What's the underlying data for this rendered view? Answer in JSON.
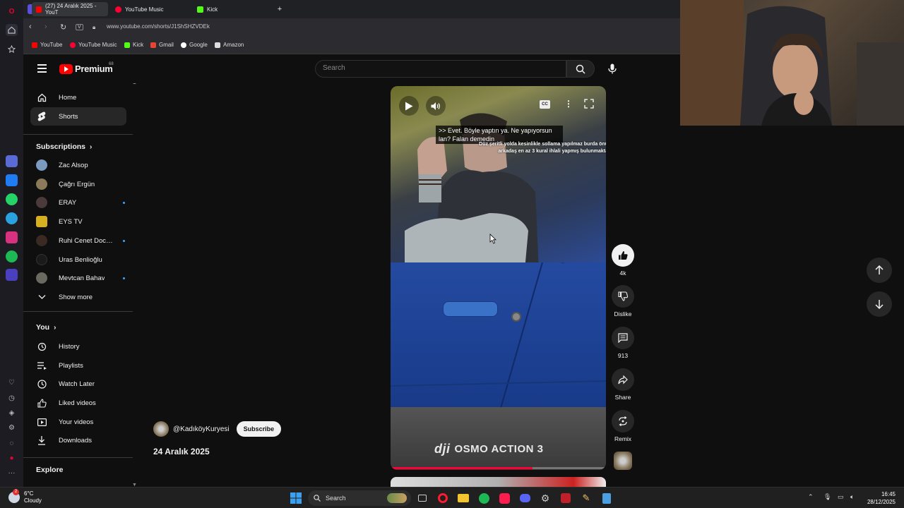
{
  "browser": {
    "tabs": [
      {
        "label": "(27) 24 Aralık 2025 - YouT",
        "active": true
      },
      {
        "label": "YouTube Music",
        "active": false
      },
      {
        "label": "Kick",
        "active": false
      }
    ],
    "new_tab_label": "+",
    "url": "www.youtube.com/shorts/J1ShSHZVDEk",
    "view_label": "V",
    "bookmarks": [
      "YouTube",
      "YouTube Music",
      "Kick",
      "Gmail",
      "Google",
      "Amazon"
    ]
  },
  "youtube": {
    "brand": "Premium",
    "premium_badge": "68",
    "search_placeholder": "Search"
  },
  "sidebar": {
    "main": [
      {
        "label": "Home",
        "icon": "home-icon"
      },
      {
        "label": "Shorts",
        "icon": "shorts-icon",
        "active": true
      }
    ],
    "subscriptions_heading": "Subscriptions",
    "subscriptions": [
      {
        "label": "Zac Alsop",
        "new": false
      },
      {
        "label": "Çağrı Ergün",
        "new": false
      },
      {
        "label": "ERAY",
        "new": true
      },
      {
        "label": "EYS TV",
        "new": false
      },
      {
        "label": "Ruhi Cenet Docu...",
        "new": true
      },
      {
        "label": "Uras Benlioğlu",
        "new": false
      },
      {
        "label": "Mevtcan Bahav",
        "new": true
      }
    ],
    "show_more": "Show more",
    "you_heading": "You",
    "you_items": [
      {
        "label": "History",
        "icon": "history-icon"
      },
      {
        "label": "Playlists",
        "icon": "playlists-icon"
      },
      {
        "label": "Watch Later",
        "icon": "watch-later-icon"
      },
      {
        "label": "Liked videos",
        "icon": "like-icon"
      },
      {
        "label": "Your videos",
        "icon": "your-videos-icon"
      },
      {
        "label": "Downloads",
        "icon": "download-icon"
      }
    ],
    "explore_heading": "Explore"
  },
  "short": {
    "caption_line1": ">> Evet. Böyle yaptın ya. Ne yapıyorsun",
    "caption_line2": "lan? Falan demedin",
    "overlay_text_line1": "Düz şeritli yolda kesinlikle sollama yapılmaz burda önü",
    "overlay_text_line2": "arkadaş en az 3 kural ihlali yapmış bulunmakta",
    "watermark_brand": "dji",
    "watermark_product": "OSMO ACTION 3",
    "progress": 0.66,
    "cc_label": "CC",
    "channel": "@KadıköyKuryesi",
    "subscribe_label": "Subscribe",
    "title": "24 Aralık 2025"
  },
  "actions": {
    "like_count": "4k",
    "dislike_label": "Dislike",
    "comment_count": "913",
    "share_label": "Share",
    "remix_label": "Remix"
  },
  "taskbar": {
    "temperature": "6°C",
    "weather": "Cloudy",
    "weather_badge": "2",
    "search_label": "Search",
    "time": "16:45",
    "date": "28/12/2025"
  },
  "colors": {
    "background": "#0f0f0f",
    "youtube_red": "#ff0000",
    "progress_red": "#ff0033",
    "accent_blue": "#3ea6ff"
  }
}
